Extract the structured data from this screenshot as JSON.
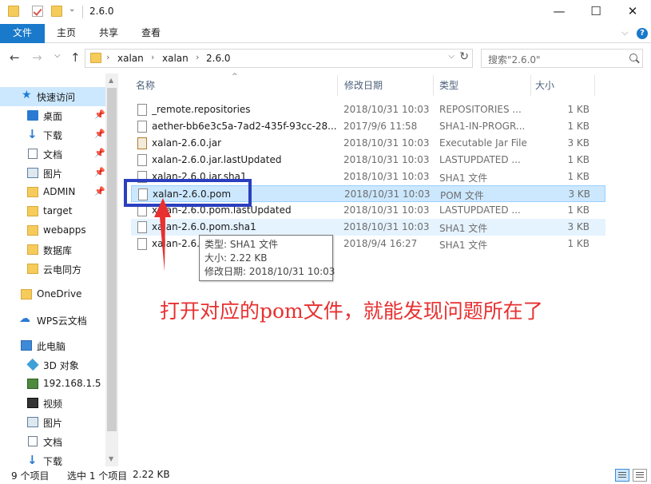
{
  "window": {
    "title": "2.6.0",
    "minimize": "—",
    "maximize": "☐",
    "close": "✕"
  },
  "ribbon": {
    "tabs": [
      "文件",
      "主页",
      "共享",
      "查看"
    ],
    "expand": "⌵"
  },
  "nav": {
    "back": "←",
    "forward": "→",
    "recent": "⌵",
    "up": "↑",
    "breadcrumbs": [
      "xalan",
      "xalan",
      "2.6.0"
    ],
    "search_placeholder": "搜索\"2.6.0\""
  },
  "sidebar": {
    "items": [
      {
        "label": "快速访问",
        "icon": "star-icon",
        "pinned": false
      },
      {
        "label": "桌面",
        "icon": "desktop-icon",
        "pinned": true
      },
      {
        "label": "下载",
        "icon": "download-icon",
        "pinned": true
      },
      {
        "label": "文档",
        "icon": "document-icon",
        "pinned": true
      },
      {
        "label": "图片",
        "icon": "pictures-icon",
        "pinned": true
      },
      {
        "label": "ADMIN",
        "icon": "folder-icon",
        "pinned": true
      },
      {
        "label": "target",
        "icon": "folder-icon",
        "pinned": false
      },
      {
        "label": "webapps",
        "icon": "folder-icon",
        "pinned": false
      },
      {
        "label": "数据库",
        "icon": "folder-icon",
        "pinned": false
      },
      {
        "label": "云电同方",
        "icon": "folder-icon",
        "pinned": false
      },
      {
        "label": "OneDrive",
        "icon": "onedrive-icon",
        "pinned": false
      },
      {
        "label": "WPS云文档",
        "icon": "cloud-icon",
        "pinned": false
      },
      {
        "label": "此电脑",
        "icon": "computer-icon",
        "pinned": false
      },
      {
        "label": "3D 对象",
        "icon": "3d-objects-icon",
        "pinned": false
      },
      {
        "label": "192.168.1.5",
        "icon": "network-drive-icon",
        "pinned": false
      },
      {
        "label": "视频",
        "icon": "video-icon",
        "pinned": false
      },
      {
        "label": "图片",
        "icon": "pictures-icon",
        "pinned": false
      },
      {
        "label": "文档",
        "icon": "document-icon",
        "pinned": false
      },
      {
        "label": "下载",
        "icon": "download-icon",
        "pinned": false
      }
    ]
  },
  "filelist": {
    "columns": [
      "名称",
      "修改日期",
      "类型",
      "大小"
    ],
    "rows": [
      {
        "name": "_remote.repositories",
        "date": "2018/10/31 10:03",
        "type": "REPOSITORIES ...",
        "size": "1 KB"
      },
      {
        "name": "aether-bb6e3c5a-7ad2-435f-93cc-28...",
        "date": "2017/9/6 11:58",
        "type": "SHA1-IN-PROGR...",
        "size": "1 KB"
      },
      {
        "name": "xalan-2.6.0.jar",
        "date": "2018/10/31 10:03",
        "type": "Executable Jar File",
        "size": "3 KB"
      },
      {
        "name": "xalan-2.6.0.jar.lastUpdated",
        "date": "2018/10/31 10:03",
        "type": "LASTUPDATED ...",
        "size": "1 KB"
      },
      {
        "name": "xalan-2.6.0.jar.sha1",
        "date": "2018/10/31 10:03",
        "type": "SHA1 文件",
        "size": "1 KB"
      },
      {
        "name": "xalan-2.6.0.pom",
        "date": "2018/10/31 10:03",
        "type": "POM 文件",
        "size": "3 KB"
      },
      {
        "name": "xalan-2.6.0.pom.lastUpdated",
        "date": "2018/10/31 10:03",
        "type": "LASTUPDATED ...",
        "size": "1 KB"
      },
      {
        "name": "xalan-2.6.0.pom.sha1",
        "date": "2018/10/31 10:03",
        "type": "SHA1 文件",
        "size": "3 KB"
      },
      {
        "name": "xalan-2.6.0",
        "date": "2018/9/4 16:27",
        "type": "SHA1 文件",
        "size": "1 KB"
      }
    ]
  },
  "tooltip": {
    "type": "类型: SHA1 文件",
    "size": "大小: 2.22 KB",
    "modified": "修改日期: 2018/10/31 10:03"
  },
  "annotation": {
    "text": "打开对应的pom文件，就能发现问题所在了",
    "color": "#e83030",
    "box_color": "#2b3fbf"
  },
  "status": {
    "item_count": "9 个项目",
    "selected": "选中 1 个项目",
    "selected_size": "2.22 KB"
  },
  "colors": {
    "accent": "#1979ca",
    "selection": "#cce8ff"
  }
}
